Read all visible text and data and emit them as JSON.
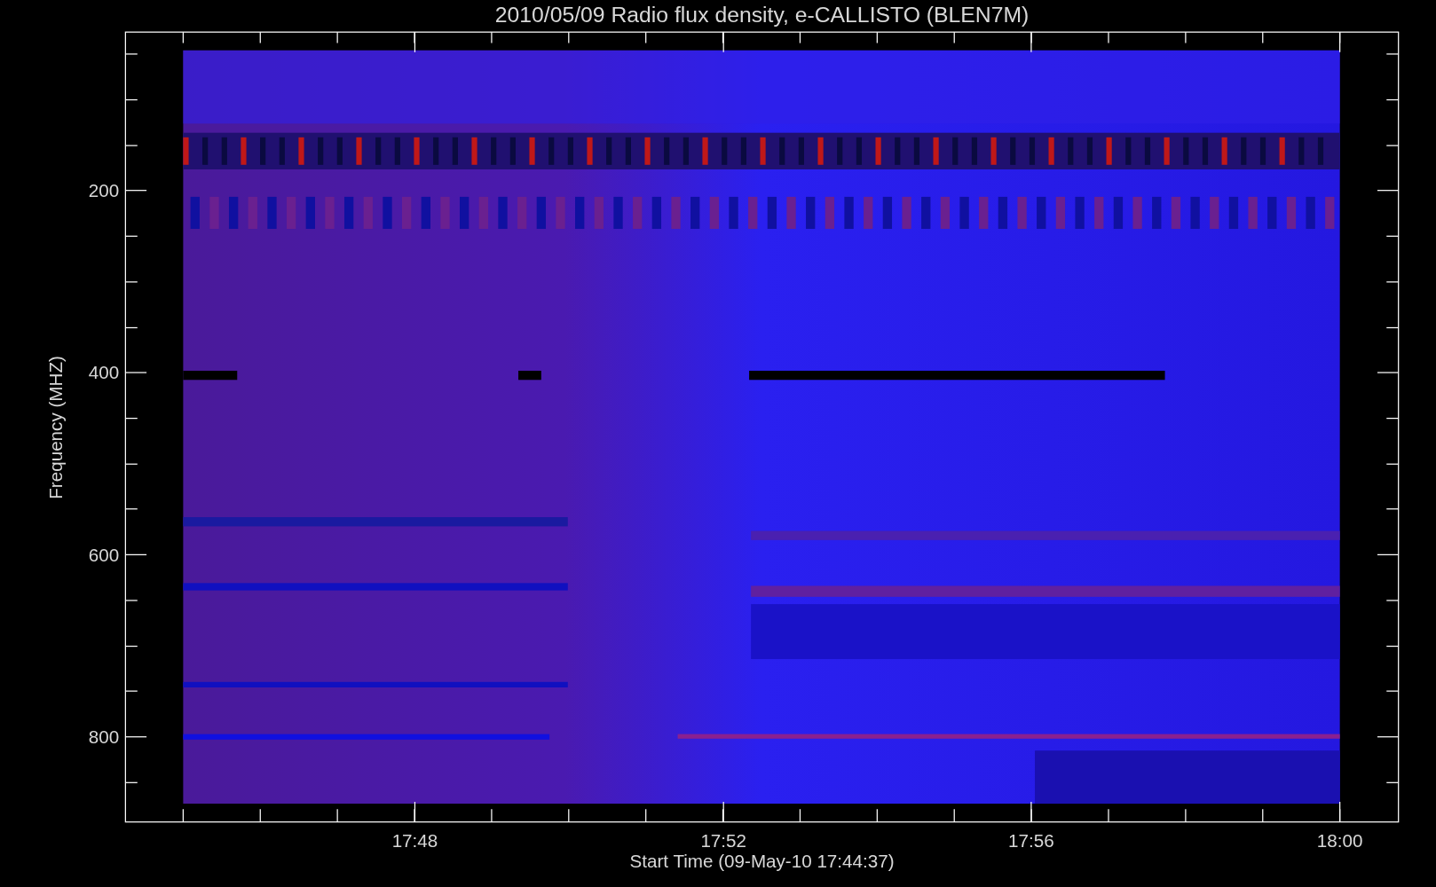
{
  "title": "2010/05/09  Radio flux density, e-CALLISTO (BLEN7M)",
  "y_axis": {
    "label": "Frequency (MHZ)",
    "ticks": [
      "200",
      "400",
      "600",
      "800"
    ]
  },
  "x_axis": {
    "label": "Start Time (09-May-10 17:44:37)",
    "ticks": [
      "17:48",
      "17:52",
      "17:56",
      "18:00"
    ]
  }
}
